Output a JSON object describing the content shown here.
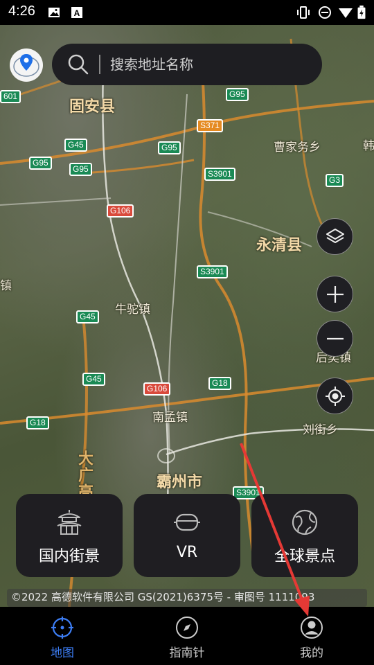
{
  "status_bar": {
    "time": "4:26"
  },
  "search": {
    "placeholder": "搜索地址名称"
  },
  "map": {
    "places": {
      "guan": "固安县",
      "caojiawu": "曹家务乡",
      "yongqing": "永清县",
      "niutuo": "牛驼镇",
      "houyi": "后奕镇",
      "nanmeng": "南孟镇",
      "liujie": "刘街乡",
      "bazhou": "霸州市",
      "dagrand": "大广高",
      "edge_left": "镇",
      "edge_right": "韩"
    },
    "shields": {
      "g95a": "G95",
      "s371": "S371",
      "g45a": "G45",
      "g95b": "G95",
      "g95c": "G95",
      "g95d": "G95",
      "s3901a": "S3901",
      "g3": "G3",
      "g106a": "G106",
      "s3901b": "S3901",
      "g45b": "G45",
      "g45c": "G45",
      "g106b": "G106",
      "g18a": "G18",
      "g18b": "G18",
      "s3901c": "S3901",
      "left601": "601"
    }
  },
  "cards": [
    {
      "label": "国内街景",
      "icon": "pagoda-icon"
    },
    {
      "label": "VR",
      "icon": "vr-headset-icon"
    },
    {
      "label": "全球景点",
      "icon": "globe-icon"
    }
  ],
  "copyright": "©2022 高德软件有限公司 GS(2021)6375号 - 审图号 1111093",
  "nav": [
    {
      "label": "地图",
      "icon": "crosshair-icon",
      "active": true
    },
    {
      "label": "指南针",
      "icon": "compass-icon",
      "active": false
    },
    {
      "label": "我的",
      "icon": "user-icon",
      "active": false
    }
  ],
  "colors": {
    "accent": "#3d7ef5",
    "panel": "#1f1e22",
    "annotation_arrow": "#e53935"
  }
}
